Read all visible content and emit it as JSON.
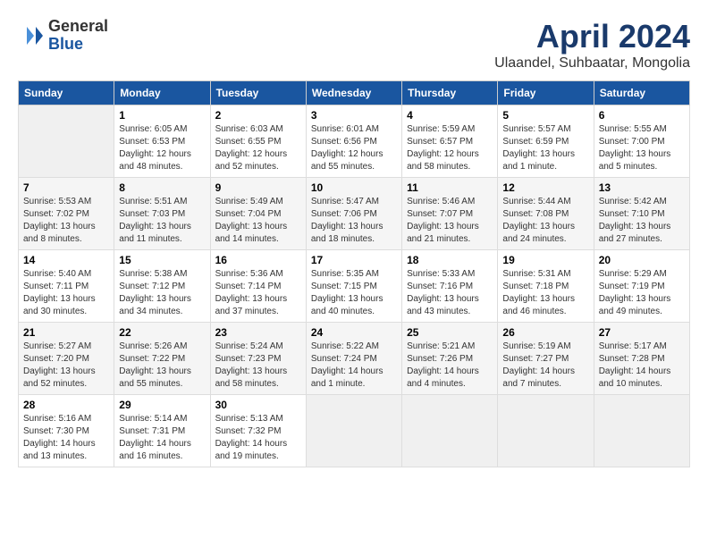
{
  "header": {
    "logo": {
      "general": "General",
      "blue": "Blue"
    },
    "title": "April 2024",
    "location": "Ulaandel, Suhbaatar, Mongolia"
  },
  "calendar": {
    "days_of_week": [
      "Sunday",
      "Monday",
      "Tuesday",
      "Wednesday",
      "Thursday",
      "Friday",
      "Saturday"
    ],
    "weeks": [
      [
        {
          "day": "",
          "info": ""
        },
        {
          "day": "1",
          "info": "Sunrise: 6:05 AM\nSunset: 6:53 PM\nDaylight: 12 hours\nand 48 minutes."
        },
        {
          "day": "2",
          "info": "Sunrise: 6:03 AM\nSunset: 6:55 PM\nDaylight: 12 hours\nand 52 minutes."
        },
        {
          "day": "3",
          "info": "Sunrise: 6:01 AM\nSunset: 6:56 PM\nDaylight: 12 hours\nand 55 minutes."
        },
        {
          "day": "4",
          "info": "Sunrise: 5:59 AM\nSunset: 6:57 PM\nDaylight: 12 hours\nand 58 minutes."
        },
        {
          "day": "5",
          "info": "Sunrise: 5:57 AM\nSunset: 6:59 PM\nDaylight: 13 hours\nand 1 minute."
        },
        {
          "day": "6",
          "info": "Sunrise: 5:55 AM\nSunset: 7:00 PM\nDaylight: 13 hours\nand 5 minutes."
        }
      ],
      [
        {
          "day": "7",
          "info": "Sunrise: 5:53 AM\nSunset: 7:02 PM\nDaylight: 13 hours\nand 8 minutes."
        },
        {
          "day": "8",
          "info": "Sunrise: 5:51 AM\nSunset: 7:03 PM\nDaylight: 13 hours\nand 11 minutes."
        },
        {
          "day": "9",
          "info": "Sunrise: 5:49 AM\nSunset: 7:04 PM\nDaylight: 13 hours\nand 14 minutes."
        },
        {
          "day": "10",
          "info": "Sunrise: 5:47 AM\nSunset: 7:06 PM\nDaylight: 13 hours\nand 18 minutes."
        },
        {
          "day": "11",
          "info": "Sunrise: 5:46 AM\nSunset: 7:07 PM\nDaylight: 13 hours\nand 21 minutes."
        },
        {
          "day": "12",
          "info": "Sunrise: 5:44 AM\nSunset: 7:08 PM\nDaylight: 13 hours\nand 24 minutes."
        },
        {
          "day": "13",
          "info": "Sunrise: 5:42 AM\nSunset: 7:10 PM\nDaylight: 13 hours\nand 27 minutes."
        }
      ],
      [
        {
          "day": "14",
          "info": "Sunrise: 5:40 AM\nSunset: 7:11 PM\nDaylight: 13 hours\nand 30 minutes."
        },
        {
          "day": "15",
          "info": "Sunrise: 5:38 AM\nSunset: 7:12 PM\nDaylight: 13 hours\nand 34 minutes."
        },
        {
          "day": "16",
          "info": "Sunrise: 5:36 AM\nSunset: 7:14 PM\nDaylight: 13 hours\nand 37 minutes."
        },
        {
          "day": "17",
          "info": "Sunrise: 5:35 AM\nSunset: 7:15 PM\nDaylight: 13 hours\nand 40 minutes."
        },
        {
          "day": "18",
          "info": "Sunrise: 5:33 AM\nSunset: 7:16 PM\nDaylight: 13 hours\nand 43 minutes."
        },
        {
          "day": "19",
          "info": "Sunrise: 5:31 AM\nSunset: 7:18 PM\nDaylight: 13 hours\nand 46 minutes."
        },
        {
          "day": "20",
          "info": "Sunrise: 5:29 AM\nSunset: 7:19 PM\nDaylight: 13 hours\nand 49 minutes."
        }
      ],
      [
        {
          "day": "21",
          "info": "Sunrise: 5:27 AM\nSunset: 7:20 PM\nDaylight: 13 hours\nand 52 minutes."
        },
        {
          "day": "22",
          "info": "Sunrise: 5:26 AM\nSunset: 7:22 PM\nDaylight: 13 hours\nand 55 minutes."
        },
        {
          "day": "23",
          "info": "Sunrise: 5:24 AM\nSunset: 7:23 PM\nDaylight: 13 hours\nand 58 minutes."
        },
        {
          "day": "24",
          "info": "Sunrise: 5:22 AM\nSunset: 7:24 PM\nDaylight: 14 hours\nand 1 minute."
        },
        {
          "day": "25",
          "info": "Sunrise: 5:21 AM\nSunset: 7:26 PM\nDaylight: 14 hours\nand 4 minutes."
        },
        {
          "day": "26",
          "info": "Sunrise: 5:19 AM\nSunset: 7:27 PM\nDaylight: 14 hours\nand 7 minutes."
        },
        {
          "day": "27",
          "info": "Sunrise: 5:17 AM\nSunset: 7:28 PM\nDaylight: 14 hours\nand 10 minutes."
        }
      ],
      [
        {
          "day": "28",
          "info": "Sunrise: 5:16 AM\nSunset: 7:30 PM\nDaylight: 14 hours\nand 13 minutes."
        },
        {
          "day": "29",
          "info": "Sunrise: 5:14 AM\nSunset: 7:31 PM\nDaylight: 14 hours\nand 16 minutes."
        },
        {
          "day": "30",
          "info": "Sunrise: 5:13 AM\nSunset: 7:32 PM\nDaylight: 14 hours\nand 19 minutes."
        },
        {
          "day": "",
          "info": ""
        },
        {
          "day": "",
          "info": ""
        },
        {
          "day": "",
          "info": ""
        },
        {
          "day": "",
          "info": ""
        }
      ]
    ]
  }
}
